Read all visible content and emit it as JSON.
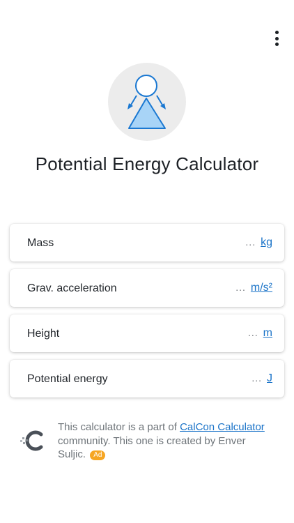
{
  "header": {
    "menu_icon": "more-vertical-icon",
    "title": "Potential Energy Calculator"
  },
  "logo": {
    "icon": "potential-energy-person-icon",
    "colors": {
      "outline": "#1a78d2",
      "fill": "#a8d4f7",
      "background": "#ececec"
    }
  },
  "fields": [
    {
      "label": "Mass",
      "placeholder": "...",
      "unit": "kg"
    },
    {
      "label": "Grav. acceleration",
      "placeholder": "...",
      "unit": "m/s²"
    },
    {
      "label": "Height",
      "placeholder": "...",
      "unit": "m"
    },
    {
      "label": "Potential energy",
      "placeholder": "...",
      "unit": "J"
    }
  ],
  "footer": {
    "logo_icon": "calcon-logo-icon",
    "text_before": "This calculator is a part of ",
    "link_text": "CalCon Calculator",
    "text_after": " community. This one is created by Enver Suljic.",
    "ad_label": "Ad"
  },
  "colors": {
    "accent": "#1a73c8",
    "ad_badge": "#f6a623",
    "text": "#1f2328",
    "muted_text": "#6e7479"
  }
}
